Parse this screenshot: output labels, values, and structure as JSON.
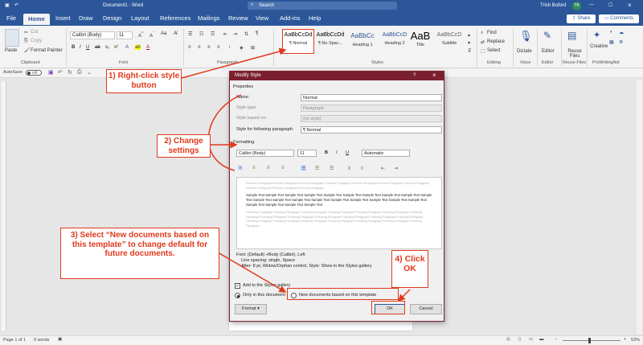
{
  "titlebar": {
    "doc_title": "Document1 - Word",
    "search_placeholder": "Search",
    "user_name": "Trish Buford",
    "user_initials": "TB"
  },
  "tabs": [
    "File",
    "Home",
    "Insert",
    "Draw",
    "Design",
    "Layout",
    "References",
    "Mailings",
    "Review",
    "View",
    "Add-ins",
    "Help"
  ],
  "share_label": "Share",
  "comments_label": "Comments",
  "ribbon": {
    "clipboard": {
      "paste": "Paste",
      "cut": "Cut",
      "copy": "Copy",
      "format_painter": "Format Painter",
      "label": "Clipboard"
    },
    "font": {
      "name": "Calibri (Body)",
      "size": "11",
      "label": "Font"
    },
    "paragraph": {
      "label": "Paragraph"
    },
    "styles": {
      "label": "Styles",
      "items": [
        {
          "preview": "AaBbCcDd",
          "name": "¶ Normal"
        },
        {
          "preview": "AaBbCcDd",
          "name": "¶ No Spac..."
        },
        {
          "preview": "AaBbCc",
          "name": "Heading 1"
        },
        {
          "preview": "AaBbCcD",
          "name": "Heading 2"
        },
        {
          "preview": "AaB",
          "name": "Title"
        },
        {
          "preview": "AaBbCcD",
          "name": "Subtitle"
        }
      ]
    },
    "editing": {
      "find": "Find",
      "replace": "Replace",
      "select": "Select",
      "label": "Editing"
    },
    "voice": {
      "dictate": "Dictate",
      "label": "Voice"
    },
    "editor": {
      "editor": "Editor",
      "label": "Editor"
    },
    "reuse": {
      "reuse": "Reuse Files",
      "label": "Reuse Files"
    },
    "prowriting": {
      "creative": "Creative",
      "label": "ProWritingAid"
    }
  },
  "qat": {
    "autosave": "AutoSave",
    "off": "Off"
  },
  "statusbar": {
    "page": "Page 1 of 1",
    "words": "0 words",
    "zoom": "53%"
  },
  "dialog": {
    "title": "Modify Style",
    "help": "?",
    "close": "×",
    "properties_label": "Properties",
    "name_label": "Name:",
    "name_value": "Normal",
    "style_type_label": "Style type:",
    "style_type_value": "Paragraph",
    "based_on_label": "Style based on:",
    "based_on_value": "(no style)",
    "following_label": "Style for following paragraph:",
    "following_value": "¶ Normal",
    "formatting_label": "Formatting",
    "font_value": "Calibri (Body)",
    "size_value": "11",
    "bold": "B",
    "italic": "I",
    "underline": "U",
    "color_value": "Automatic",
    "preview_prev": "Previous Paragraph Previous Paragraph Previous Paragraph Previous Paragraph Previous Paragraph Previous Paragraph Previous Paragraph Previous Paragraph Previous Paragraph Previous Paragraph",
    "preview_sample": "Sample Text Sample Text Sample Text Sample Text Sample Text Sample Text Sample Text Sample Text Sample Text Sample Text Sample Text Sample Text Sample Text Sample Text Sample Text Sample Text Sample Text Sample Text Sample Text Sample Text Sample Text Sample Text Sample Text",
    "preview_next": "Following Paragraph Following Paragraph Following Paragraph Following Paragraph Following Paragraph Following Paragraph Following Paragraph Following Paragraph Following Paragraph Following Paragraph Following Paragraph Following Paragraph Following Paragraph Following Paragraph Following Paragraph Following Paragraph Following Paragraph Following Paragraph Following Paragraph Following Paragraph",
    "desc_line1": "Font: (Default) +Body (Calibri), Left",
    "desc_line2": "Line spacing:  single, Space",
    "desc_line3": "After:  8 pt, Widow/Orphan control, Style: Show in the Styles gallery",
    "add_gallery": "Add to the Styles gallery",
    "only_doc": "Only in this document",
    "new_docs": "New documents based on this template",
    "format_btn": "Format",
    "ok_btn": "OK",
    "cancel_btn": "Cancel"
  },
  "callouts": {
    "c1": "1) Right-click style button",
    "c2": "2) Change settings",
    "c3": "3) Select “New documents based on this template” to change default for future documents.",
    "c4": "4) Click OK"
  },
  "colors": {
    "word_blue": "#2b579a",
    "dialog_title": "#7a1f2e",
    "callout_red": "#e0391c"
  }
}
